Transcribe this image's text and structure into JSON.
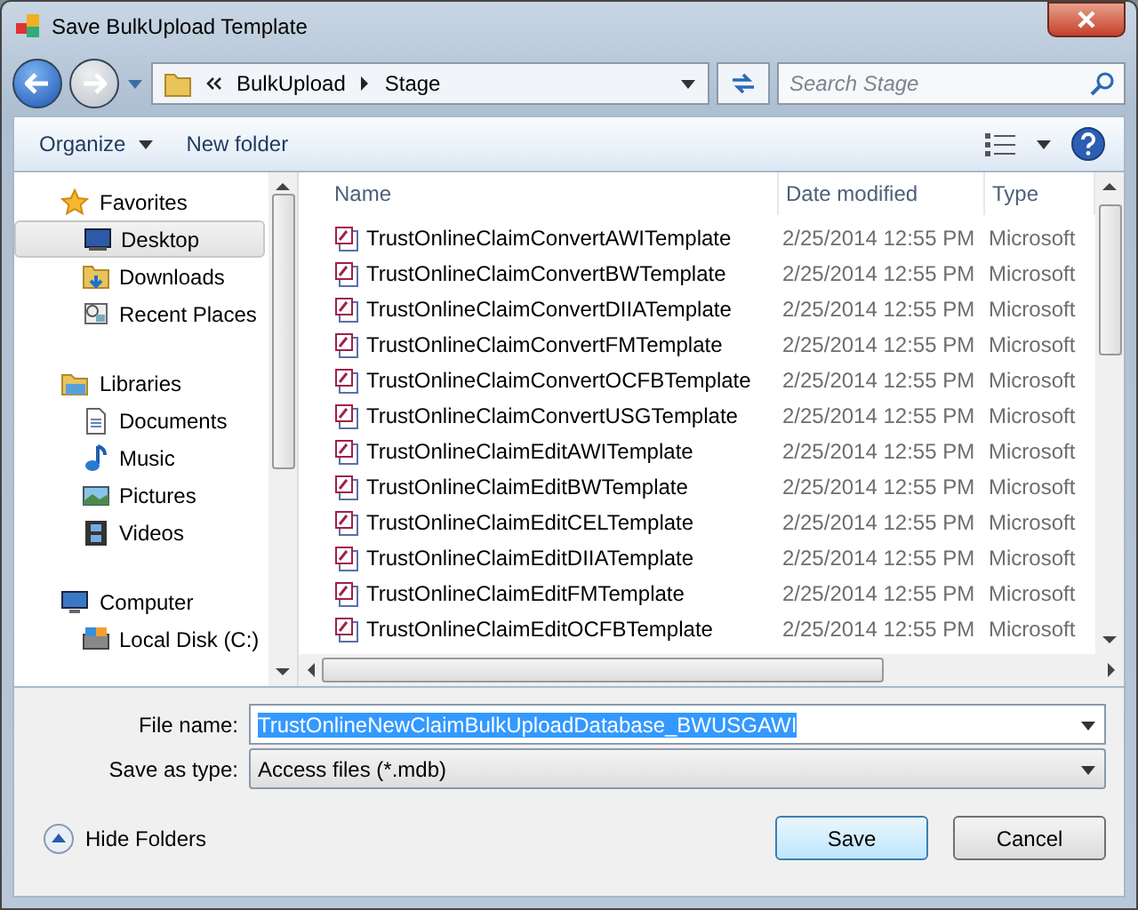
{
  "window": {
    "title": "Save BulkUpload Template"
  },
  "address": {
    "path": [
      {
        "label": "BulkUpload"
      },
      {
        "label": "Stage"
      }
    ]
  },
  "search": {
    "placeholder": "Search Stage"
  },
  "toolbar": {
    "organize": "Organize",
    "new_folder": "New folder"
  },
  "sidebar": {
    "groups": [
      {
        "label": "Favorites",
        "children": [
          {
            "label": "Desktop",
            "selected": true
          },
          {
            "label": "Downloads",
            "selected": false
          },
          {
            "label": "Recent Places",
            "selected": false
          }
        ]
      },
      {
        "label": "Libraries",
        "children": [
          {
            "label": "Documents",
            "selected": false
          },
          {
            "label": "Music",
            "selected": false
          },
          {
            "label": "Pictures",
            "selected": false
          },
          {
            "label": "Videos",
            "selected": false
          }
        ]
      },
      {
        "label": "Computer",
        "children": [
          {
            "label": "Local Disk (C:)",
            "selected": false
          }
        ]
      }
    ]
  },
  "table": {
    "columns": [
      "Name",
      "Date modified",
      "Type"
    ],
    "rows": [
      {
        "name": "TrustOnlineClaimConvertAWITemplate",
        "date": "2/25/2014 12:55 PM",
        "type": "Microsoft"
      },
      {
        "name": "TrustOnlineClaimConvertBWTemplate",
        "date": "2/25/2014 12:55 PM",
        "type": "Microsoft"
      },
      {
        "name": "TrustOnlineClaimConvertDIIATemplate",
        "date": "2/25/2014 12:55 PM",
        "type": "Microsoft"
      },
      {
        "name": "TrustOnlineClaimConvertFMTemplate",
        "date": "2/25/2014 12:55 PM",
        "type": "Microsoft"
      },
      {
        "name": "TrustOnlineClaimConvertOCFBTemplate",
        "date": "2/25/2014 12:55 PM",
        "type": "Microsoft"
      },
      {
        "name": "TrustOnlineClaimConvertUSGTemplate",
        "date": "2/25/2014 12:55 PM",
        "type": "Microsoft"
      },
      {
        "name": "TrustOnlineClaimEditAWITemplate",
        "date": "2/25/2014 12:55 PM",
        "type": "Microsoft"
      },
      {
        "name": "TrustOnlineClaimEditBWTemplate",
        "date": "2/25/2014 12:55 PM",
        "type": "Microsoft"
      },
      {
        "name": "TrustOnlineClaimEditCELTemplate",
        "date": "2/25/2014 12:55 PM",
        "type": "Microsoft"
      },
      {
        "name": "TrustOnlineClaimEditDIIATemplate",
        "date": "2/25/2014 12:55 PM",
        "type": "Microsoft"
      },
      {
        "name": "TrustOnlineClaimEditFMTemplate",
        "date": "2/25/2014 12:55 PM",
        "type": "Microsoft"
      },
      {
        "name": "TrustOnlineClaimEditOCFBTemplate",
        "date": "2/25/2014 12:55 PM",
        "type": "Microsoft"
      }
    ]
  },
  "form": {
    "file_name_label": "File name:",
    "file_name": "TrustOnlineNewClaimBulkUploadDatabase_BWUSGAWI",
    "file_name_selected": true,
    "type_label": "Save as type:",
    "type_value": "Access files (*.mdb)"
  },
  "footer": {
    "hide_folders": "Hide Folders",
    "buttons": [
      "Save",
      "Cancel"
    ]
  }
}
